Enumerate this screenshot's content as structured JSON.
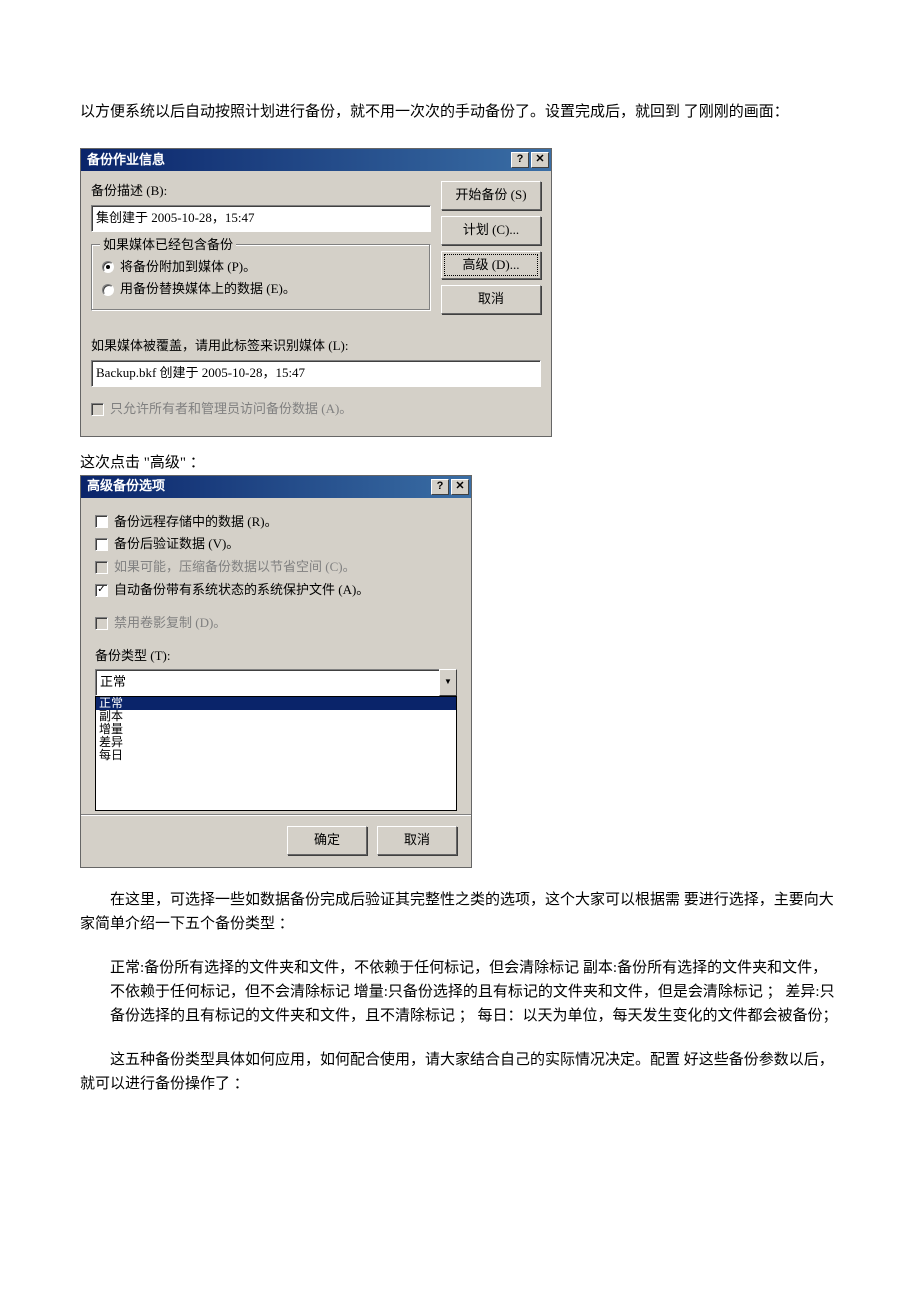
{
  "intro": "以方便系统以后自动按照计划进行备份，就不用一次次的手动备份了。设置完成后，就回到 了刚刚的画面：",
  "dialog1": {
    "title": "备份作业信息",
    "desc_label": "备份描述 (B):",
    "desc_value": "集创建于 2005-10-28，15:47",
    "group_title": "如果媒体已经包含备份",
    "radio1": "将备份附加到媒体 (P)。",
    "radio2": "用备份替换媒体上的数据 (E)。",
    "override_label": "如果媒体被覆盖，请用此标签来识别媒体 (L):",
    "override_value": "Backup.bkf 创建于 2005-10-28，15:47",
    "allow_only": "只允许所有者和管理员访问备份数据 (A)。",
    "btn_start": "开始备份 (S)",
    "btn_sched": "计划 (C)...",
    "btn_adv": "高级 (D)...",
    "btn_cancel": "取消"
  },
  "mid_text": "这次点击 \"高级\" ：",
  "dialog2": {
    "title": "高级备份选项",
    "chk_remote": "备份远程存储中的数据 (R)。",
    "chk_verify": "备份后验证数据 (V)。",
    "chk_compress": "如果可能，压缩备份数据以节省空间 (C)。",
    "chk_sysprotect": "自动备份带有系统状态的系统保护文件 (A)。",
    "chk_vss": "禁用卷影复制 (D)。",
    "type_label": "备份类型 (T):",
    "type_selected": "正常",
    "type_options": [
      "正常",
      "副本",
      "增量",
      "差异",
      "每日"
    ],
    "btn_ok": "确定",
    "btn_cancel": "取消"
  },
  "para1": "在这里，可选择一些如数据备份完成后验证其完整性之类的选项，这个大家可以根据需 要进行选择，主要向大家简单介绍一下五个备份类型 ：",
  "para2": "正常:备份所有选择的文件夹和文件，不依赖于任何标记，但会清除标记 副本:备份所有选择的文件夹和文件，不依赖于任何标记，但不会清除标记 增量:只备份选择的且有标记的文件夹和文件，但是会清除标记 ；  差异:只备份选择的且有标记的文件夹和文件，且不清除标记 ；  每日：以天为单位，每天发生变化的文件都会被备份；",
  "para3": "这五种备份类型具体如何应用，如何配合使用，请大家结合自己的实际情况决定。配置 好这些备份参数以后，就可以进行备份操作了 ："
}
